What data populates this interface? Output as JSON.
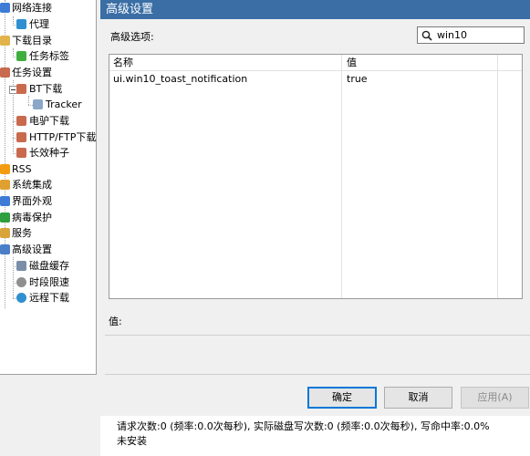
{
  "tree": {
    "items": [
      {
        "label": "网络连接",
        "icon": "network-icon",
        "color": "#3d7bd6"
      },
      {
        "label": "代理",
        "icon": "proxy-icon",
        "color": "#2f8fd0"
      },
      {
        "label": "下载目录",
        "icon": "folder-icon",
        "color": "#e1b34a"
      },
      {
        "label": "任务标签",
        "icon": "tag-icon",
        "color": "#3fae3f"
      },
      {
        "label": "任务设置",
        "icon": "task-settings-icon",
        "color": "#c96a4e"
      },
      {
        "label": "BT下载",
        "icon": "bt-download-icon",
        "color": "#c96a4e"
      },
      {
        "label": "Tracker",
        "icon": "tracker-icon",
        "color": "#8aa7c7"
      },
      {
        "label": "电驴下载",
        "icon": "edonkey-icon",
        "color": "#c96a4e"
      },
      {
        "label": "HTTP/FTP下载",
        "icon": "http-ftp-icon",
        "color": "#c96a4e"
      },
      {
        "label": "长效种子",
        "icon": "seed-icon",
        "color": "#c96a4e"
      },
      {
        "label": "RSS",
        "icon": "rss-icon",
        "color": "#f39c12"
      },
      {
        "label": "系统集成",
        "icon": "system-integration-icon",
        "color": "#e0a030"
      },
      {
        "label": "界面外观",
        "icon": "appearance-icon",
        "color": "#3d7bd6"
      },
      {
        "label": "病毒保护",
        "icon": "shield-icon",
        "color": "#2e9e3e"
      },
      {
        "label": "服务",
        "icon": "service-icon",
        "color": "#d9a43a"
      },
      {
        "label": "高级设置",
        "icon": "advanced-settings-icon",
        "color": "#4a7ec7"
      },
      {
        "label": "磁盘缓存",
        "icon": "disk-cache-icon",
        "color": "#7a8ea8"
      },
      {
        "label": "时段限速",
        "icon": "clock-icon",
        "color": "#8f8f8f"
      },
      {
        "label": "远程下载",
        "icon": "globe-icon",
        "color": "#2f8fd0"
      }
    ]
  },
  "header": {
    "title": "高级设置"
  },
  "options": {
    "label": "高级选项:"
  },
  "search": {
    "value": "win10"
  },
  "table": {
    "headers": [
      "名称",
      "值"
    ],
    "rows": [
      {
        "name": "ui.win10_toast_notification",
        "value": "true"
      }
    ]
  },
  "value_field": {
    "label": "值:"
  },
  "buttons": {
    "ok": "确定",
    "cancel": "取消",
    "apply": "应用(A)"
  },
  "status": {
    "line1": "请求次数:0 (频率:0.0次每秒), 实际磁盘写次数:0 (频率:0.0次每秒), 写命中率:0.0%",
    "line2": "未安装"
  },
  "colors": {
    "header_bg": "#3a6ea5",
    "accent": "#0078d7"
  }
}
